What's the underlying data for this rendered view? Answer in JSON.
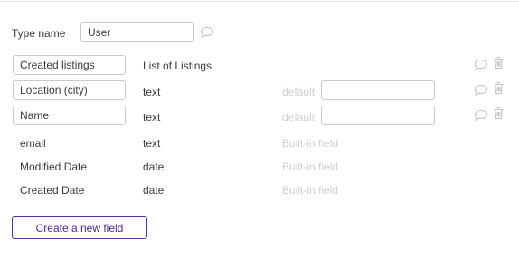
{
  "type_name": {
    "label": "Type name",
    "value": "User"
  },
  "fields": [
    {
      "name": "Created listings",
      "type": "List of Listings",
      "editable": true,
      "default_label": "",
      "builtin_label": ""
    },
    {
      "name": "Location (city)",
      "type": "text",
      "editable": true,
      "default_label": "default",
      "builtin_label": ""
    },
    {
      "name": "Name",
      "type": "text",
      "editable": true,
      "default_label": "default",
      "builtin_label": ""
    },
    {
      "name": "email",
      "type": "text",
      "editable": false,
      "default_label": "",
      "builtin_label": "Built-in field"
    },
    {
      "name": "Modified Date",
      "type": "date",
      "editable": false,
      "default_label": "",
      "builtin_label": "Built-in field"
    },
    {
      "name": "Created Date",
      "type": "date",
      "editable": false,
      "default_label": "",
      "builtin_label": "Built-in field"
    }
  ],
  "actions": {
    "create_field_label": "Create a new field"
  },
  "colors": {
    "accent": "#4b1fa0",
    "muted_text": "#cfcfcf",
    "icon": "#c2c2c2",
    "border": "#c9c9c9"
  },
  "icons": {
    "comment": "speech-bubble-icon",
    "delete": "trash-icon"
  }
}
